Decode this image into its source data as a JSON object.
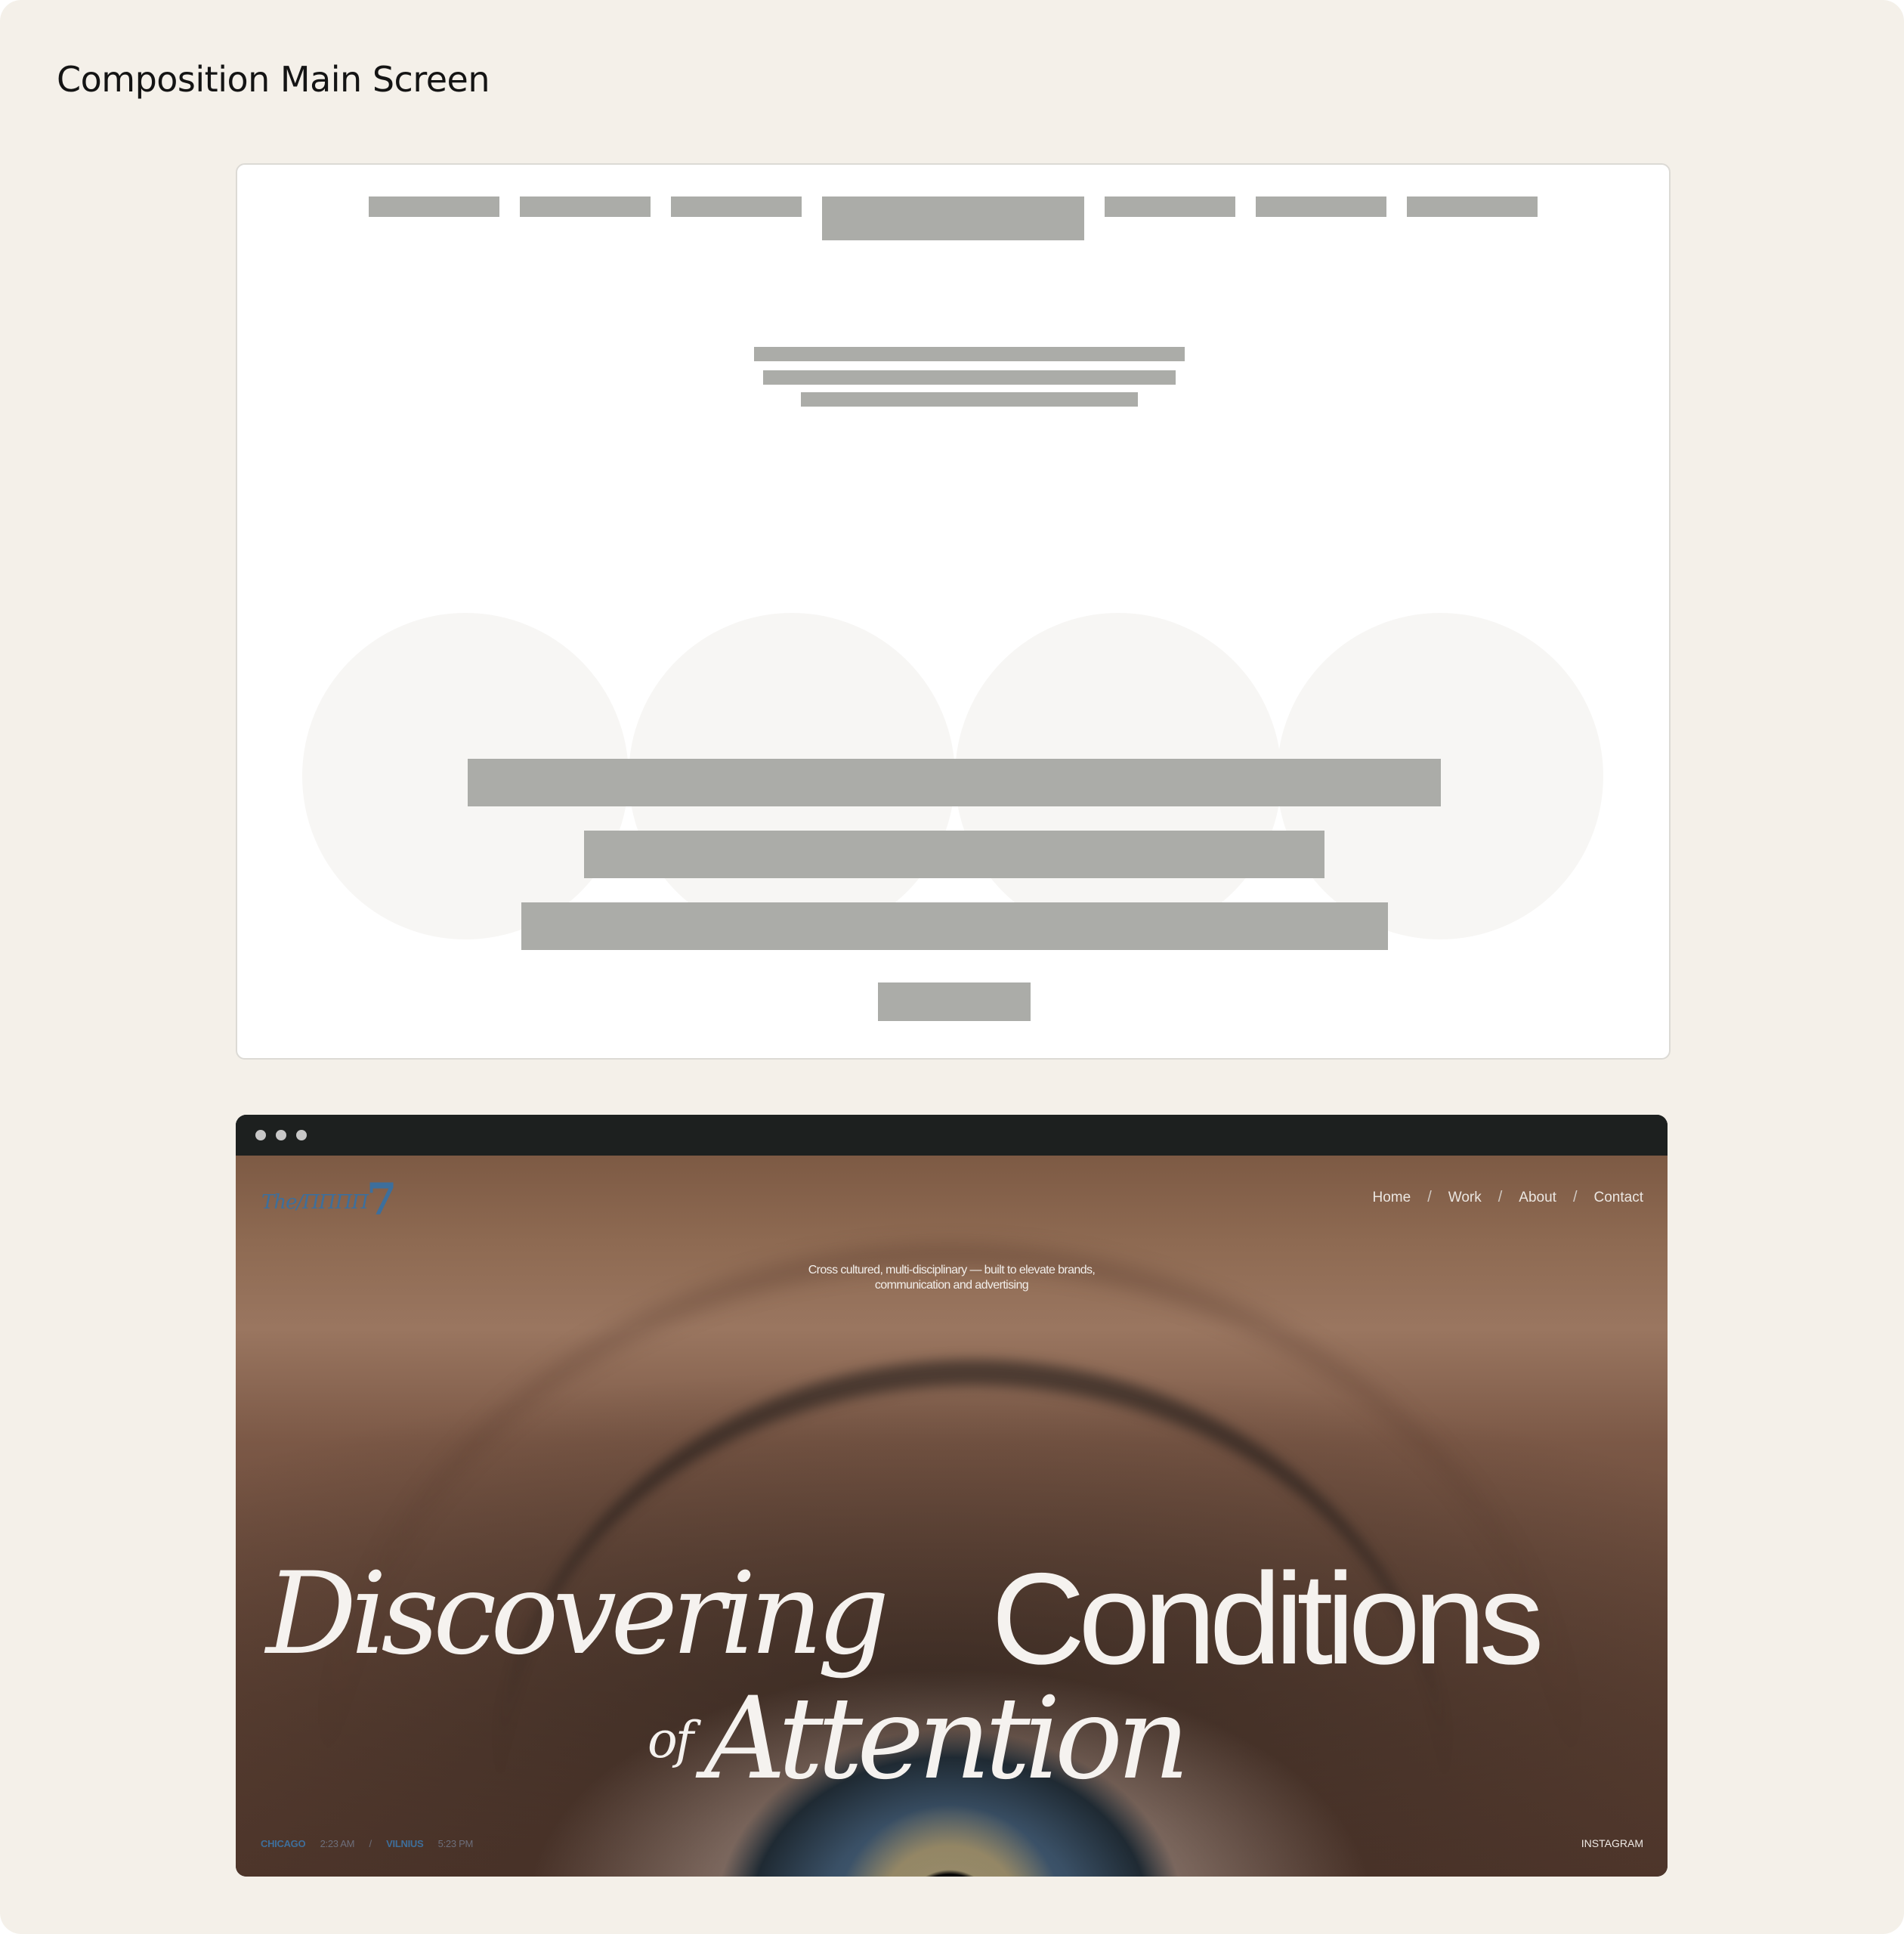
{
  "page": {
    "title": "Composition Main Screen"
  },
  "colors": {
    "canvas_background": "#f4f0e9",
    "placeholder": "#abaca8",
    "wire_circle": "#f7f6f4",
    "browser_chrome": "#1d201f",
    "logo_blue": "#3d6f9c"
  },
  "wireframe": {
    "nav_placeholder_count": 7,
    "intro_line_count": 3,
    "headline_line_count": 3,
    "background_circle_count": 4,
    "has_button_placeholder": true
  },
  "browser": {
    "window_controls": [
      "dot",
      "dot",
      "dot"
    ],
    "site": {
      "logo_text": "The/ΠΠΠΠ",
      "logo_numeral": "7",
      "nav": [
        {
          "label": "Home"
        },
        {
          "label": "Work"
        },
        {
          "label": "About"
        },
        {
          "label": "Contact"
        }
      ],
      "nav_separator": "/",
      "tagline_line1": "Cross cultured, multi-disciplinary — built to elevate brands,",
      "tagline_line2": "communication and advertising",
      "headline": {
        "word1": "Discovering",
        "word2": "Conditions",
        "word3": "of",
        "word4": "Attention"
      },
      "footer": {
        "city1": "CHICAGO",
        "time1": "2:23 AM",
        "separator": "/",
        "city2": "VILNIUS",
        "time2": "5:23 PM",
        "social": "INSTAGRAM"
      }
    }
  }
}
